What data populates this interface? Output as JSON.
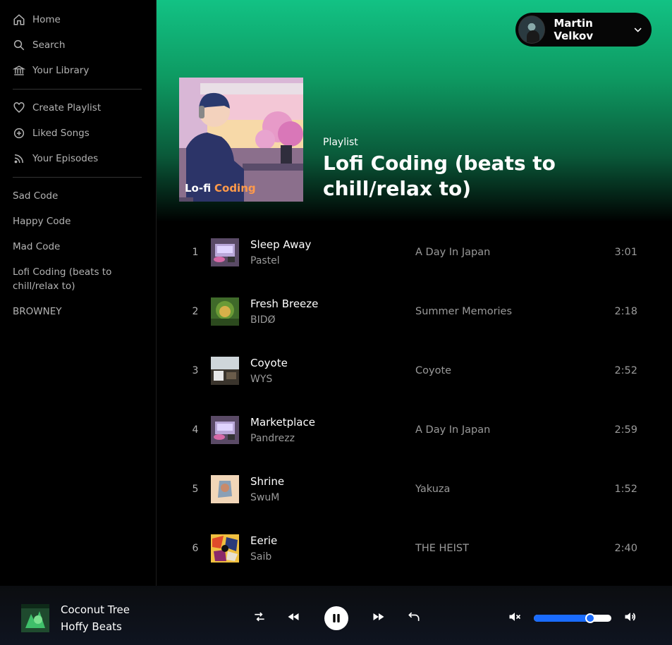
{
  "sidebar": {
    "nav": [
      {
        "label": "Home",
        "icon": "home-icon"
      },
      {
        "label": "Search",
        "icon": "search-icon"
      },
      {
        "label": "Your Library",
        "icon": "library-icon"
      }
    ],
    "actions": [
      {
        "label": "Create Playlist",
        "icon": "heart-icon"
      },
      {
        "label": "Liked Songs",
        "icon": "plus-circle-icon"
      },
      {
        "label": "Your Episodes",
        "icon": "rss-icon"
      }
    ],
    "playlists": [
      "Sad Code",
      "Happy Code",
      "Mad Code",
      "Lofi Coding (beats to chill/relax to)",
      "BROWNEY"
    ]
  },
  "header": {
    "user_name": "Martin Velkov"
  },
  "playlist": {
    "type_label": "Playlist",
    "title": "Lofi Coding (beats to chill/relax to)",
    "cover_text_a": "Lo-fi",
    "cover_text_b": "Coding"
  },
  "tracks": [
    {
      "num": "1",
      "name": "Sleep Away",
      "artist": "Pastel",
      "album": "A Day In Japan",
      "duration": "3:01"
    },
    {
      "num": "2",
      "name": "Fresh Breeze",
      "artist": "BIDØ",
      "album": "Summer Memories",
      "duration": "2:18"
    },
    {
      "num": "3",
      "name": "Coyote",
      "artist": "WYS",
      "album": "Coyote",
      "duration": "2:52"
    },
    {
      "num": "4",
      "name": "Marketplace",
      "artist": "Pandrezz",
      "album": "A Day In Japan",
      "duration": "2:59"
    },
    {
      "num": "5",
      "name": "Shrine",
      "artist": "SwuM",
      "album": "Yakuza",
      "duration": "1:52"
    },
    {
      "num": "6",
      "name": "Eerie",
      "artist": "Saib",
      "album": "THE HEIST",
      "duration": "2:40"
    }
  ],
  "player": {
    "title": "Coconut Tree",
    "artist": "Hoffy Beats",
    "volume": 0.73
  },
  "colors": {
    "accent": "#12c284",
    "volume": "#1a6cff"
  }
}
